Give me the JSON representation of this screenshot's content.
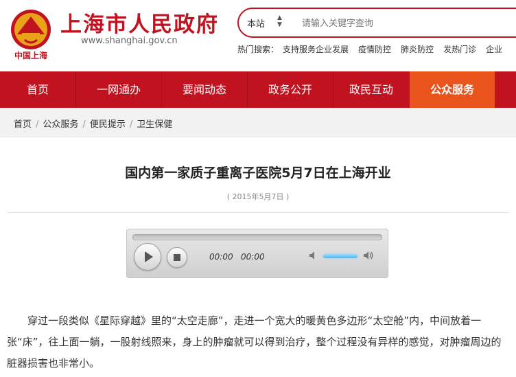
{
  "header": {
    "site_title": "上海市人民政府",
    "site_url": "www.shanghai.gov.cn",
    "emblem_caption": "中国上海"
  },
  "search": {
    "scope": "本站",
    "placeholder": "请输入关键字查询",
    "hot_label": "热门搜索：",
    "hot_items": [
      "支持服务企业发展",
      "疫情防控",
      "肺炎防控",
      "发热门诊",
      "企业"
    ]
  },
  "nav": {
    "items": [
      "首页",
      "一网通办",
      "要闻动态",
      "政务公开",
      "政民互动",
      "公众服务"
    ],
    "active": "公众服务"
  },
  "breadcrumb": [
    "首页",
    "公众服务",
    "便民提示",
    "卫生保健"
  ],
  "article": {
    "title": "国内第一家质子重离子医院5月7日在上海开业",
    "date": "( 2015年5月7日 )",
    "paragraph": "穿过一段类似《星际穿越》里的“太空走廊”，走进一个宽大的暖黄色多边形“太空舱”内，中间放着一张“床”，往上面一躺，一股射线照来，身上的肿瘤就可以得到治疗，整个过程没有异样的感觉，对肿瘤周边的脏器损害也非常小。"
  },
  "player": {
    "current_time": "00:00",
    "duration": "00:00",
    "progress": 0,
    "volume": 1
  },
  "colors": {
    "brand_red": "#c1121f",
    "active_orange": "#e9541d"
  }
}
